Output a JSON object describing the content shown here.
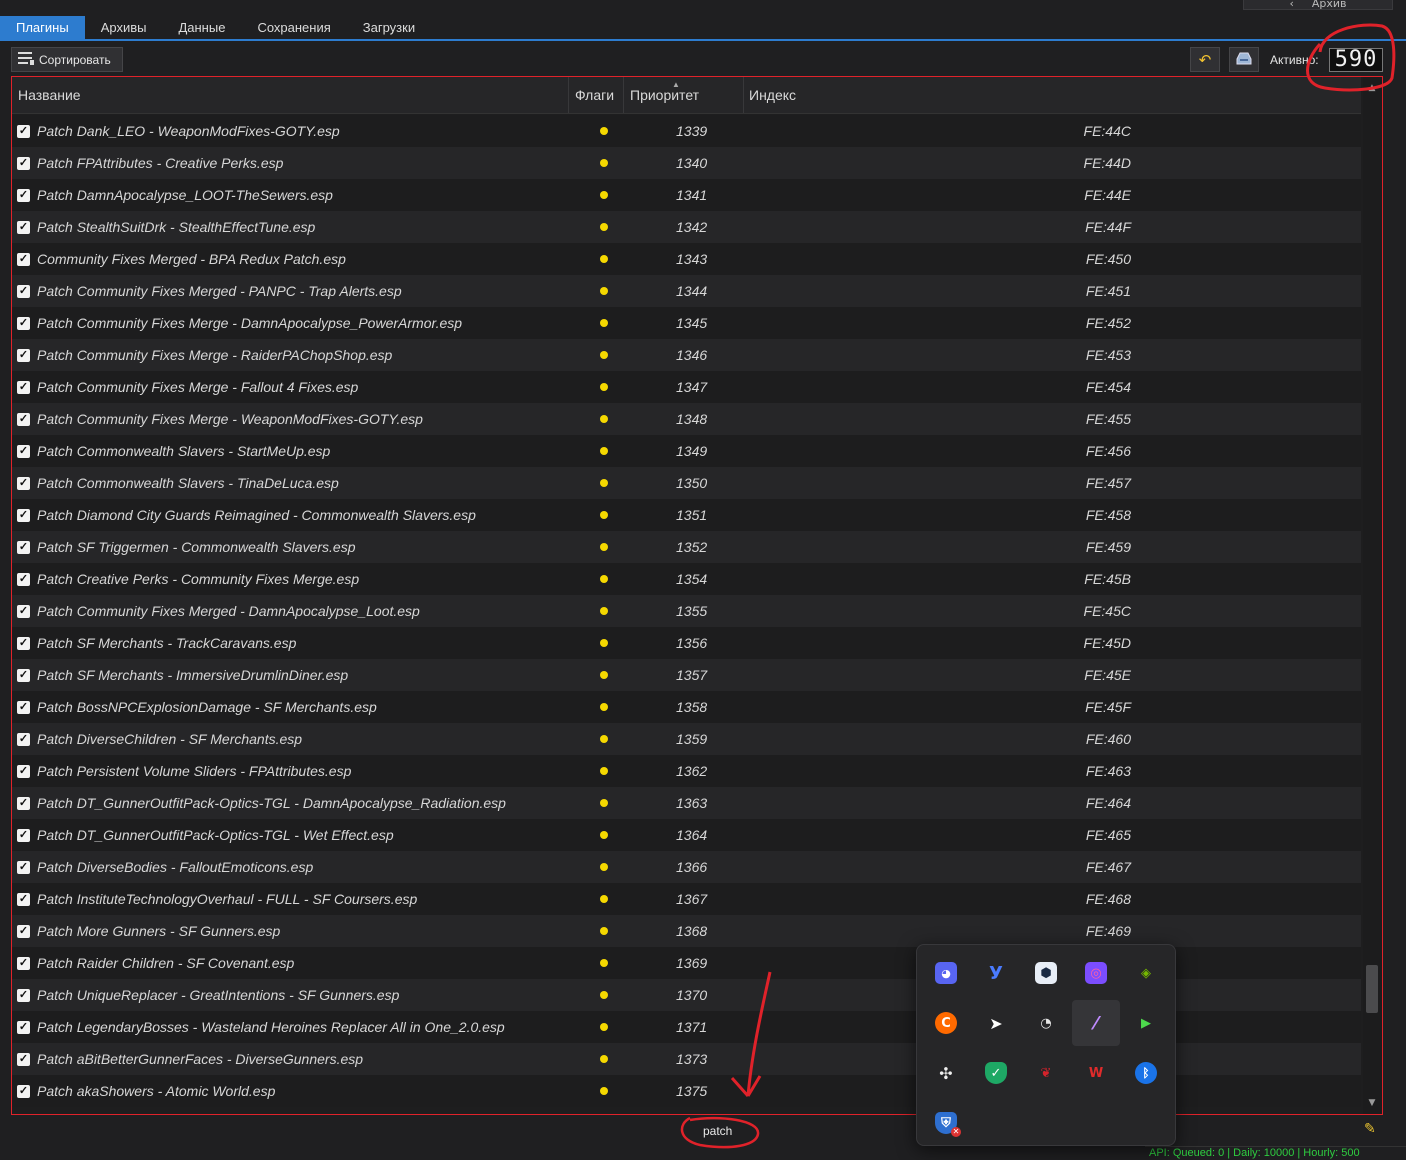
{
  "archive_button": {
    "label": "Архив"
  },
  "tabs": [
    {
      "label": "Плагины",
      "active": true
    },
    {
      "label": "Архивы",
      "active": false
    },
    {
      "label": "Данные",
      "active": false
    },
    {
      "label": "Сохранения",
      "active": false
    },
    {
      "label": "Загрузки",
      "active": false
    }
  ],
  "toolbar": {
    "sort_label": "Сортировать",
    "active_label": "Активно:",
    "active_count": "590"
  },
  "columns": {
    "name": "Название",
    "flags": "Флаги",
    "priority": "Приоритет",
    "index": "Индекс"
  },
  "rows": [
    {
      "name": "Patch Dank_LEO - WeaponModFixes-GOTY.esp",
      "priority": "1339",
      "index": "FE:44C"
    },
    {
      "name": "Patch FPAttributes - Creative Perks.esp",
      "priority": "1340",
      "index": "FE:44D"
    },
    {
      "name": "Patch DamnApocalypse_LOOT-TheSewers.esp",
      "priority": "1341",
      "index": "FE:44E"
    },
    {
      "name": "Patch StealthSuitDrk - StealthEffectTune.esp",
      "priority": "1342",
      "index": "FE:44F"
    },
    {
      "name": "Community Fixes Merged - BPA Redux Patch.esp",
      "priority": "1343",
      "index": "FE:450"
    },
    {
      "name": "Patch Community Fixes Merged - PANPC - Trap Alerts.esp",
      "priority": "1344",
      "index": "FE:451"
    },
    {
      "name": "Patch Community Fixes Merge - DamnApocalypse_PowerArmor.esp",
      "priority": "1345",
      "index": "FE:452"
    },
    {
      "name": "Patch Community Fixes Merge - RaiderPAChopShop.esp",
      "priority": "1346",
      "index": "FE:453"
    },
    {
      "name": "Patch Community Fixes Merge - Fallout 4 Fixes.esp",
      "priority": "1347",
      "index": "FE:454"
    },
    {
      "name": "Patch Community Fixes Merge - WeaponModFixes-GOTY.esp",
      "priority": "1348",
      "index": "FE:455"
    },
    {
      "name": "Patch Commonwealth Slavers - StartMeUp.esp",
      "priority": "1349",
      "index": "FE:456"
    },
    {
      "name": "Patch Commonwealth Slavers - TinaDeLuca.esp",
      "priority": "1350",
      "index": "FE:457"
    },
    {
      "name": "Patch Diamond City Guards Reimagined - Commonwealth Slavers.esp",
      "priority": "1351",
      "index": "FE:458"
    },
    {
      "name": "Patch SF Triggermen - Commonwealth Slavers.esp",
      "priority": "1352",
      "index": "FE:459"
    },
    {
      "name": "Patch Creative Perks - Community Fixes Merge.esp",
      "priority": "1354",
      "index": "FE:45B"
    },
    {
      "name": "Patch Community Fixes Merged - DamnApocalypse_Loot.esp",
      "priority": "1355",
      "index": "FE:45C"
    },
    {
      "name": "Patch SF Merchants - TrackCaravans.esp",
      "priority": "1356",
      "index": "FE:45D"
    },
    {
      "name": "Patch SF Merchants - ImmersiveDrumlinDiner.esp",
      "priority": "1357",
      "index": "FE:45E"
    },
    {
      "name": "Patch BossNPCExplosionDamage - SF Merchants.esp",
      "priority": "1358",
      "index": "FE:45F"
    },
    {
      "name": "Patch DiverseChildren - SF Merchants.esp",
      "priority": "1359",
      "index": "FE:460"
    },
    {
      "name": "Patch Persistent Volume Sliders - FPAttributes.esp",
      "priority": "1362",
      "index": "FE:463"
    },
    {
      "name": "Patch DT_GunnerOutfitPack-Optics-TGL - DamnApocalypse_Radiation.esp",
      "priority": "1363",
      "index": "FE:464"
    },
    {
      "name": "Patch DT_GunnerOutfitPack-Optics-TGL - Wet Effect.esp",
      "priority": "1364",
      "index": "FE:465"
    },
    {
      "name": "Patch DiverseBodies - FalloutEmoticons.esp",
      "priority": "1366",
      "index": "FE:467"
    },
    {
      "name": "Patch InstituteTechnologyOverhaul - FULL - SF Coursers.esp",
      "priority": "1367",
      "index": "FE:468"
    },
    {
      "name": "Patch More Gunners - SF Gunners.esp",
      "priority": "1368",
      "index": "FE:469"
    },
    {
      "name": "Patch Raider Children - SF Covenant.esp",
      "priority": "1369",
      "index": ""
    },
    {
      "name": "Patch UniqueReplacer - GreatIntentions - SF Gunners.esp",
      "priority": "1370",
      "index": ""
    },
    {
      "name": "Patch LegendaryBosses - Wasteland Heroines Replacer All in One_2.0.esp",
      "priority": "1371",
      "index": ""
    },
    {
      "name": "Patch aBitBetterGunnerFaces - DiverseGunners.esp",
      "priority": "1373",
      "index": ""
    },
    {
      "name": "Patch akaShowers - Atomic World.esp",
      "priority": "1375",
      "index": ""
    }
  ],
  "filter": {
    "value": "patch"
  },
  "status_bar": {
    "text": "API: Queued: 0 | Daily: 10000 | Hourly: 500"
  },
  "tray_icons": [
    "discord-icon",
    "yandex-icon",
    "app-hex-icon",
    "camera-app-icon",
    "nvidia-icon",
    "ccleaner-icon",
    "telegram-icon",
    "speedometer-icon",
    "feather-icon",
    "play-arrow-icon",
    "fan-icon",
    "shield-check-icon",
    "razer-icon",
    "msi-icon",
    "bluetooth-icon",
    "security-alert-icon"
  ],
  "colors": {
    "accent": "#2d7ccf",
    "flag_dot": "#f5d800",
    "annotation": "#e0222a",
    "status_text": "#2ecc40"
  }
}
